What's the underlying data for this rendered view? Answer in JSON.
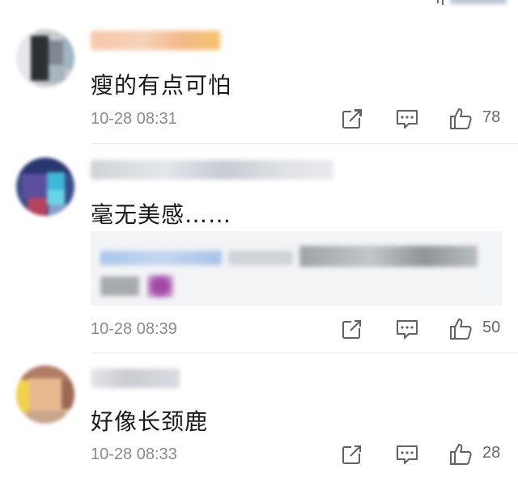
{
  "comments": [
    {
      "text": "瘦的有点可怕",
      "time": "10-28 08:31",
      "likes": "78",
      "icons": [
        "share-icon",
        "comment-icon",
        "like-icon"
      ]
    },
    {
      "text": "毫无美感……",
      "time": "10-28 08:39",
      "likes": "50",
      "icons": [
        "share-icon",
        "comment-icon",
        "like-icon"
      ]
    },
    {
      "text": "好像长颈鹿",
      "time": "10-28 08:33",
      "likes": "28",
      "icons": [
        "share-icon",
        "comment-icon",
        "like-icon"
      ]
    }
  ],
  "colors": {
    "text": "#1a1a1a",
    "meta": "#8a8a8a",
    "icon": "#5f6368",
    "sort": "#5a6f8f",
    "reply_bg": "#f3f4f6"
  }
}
